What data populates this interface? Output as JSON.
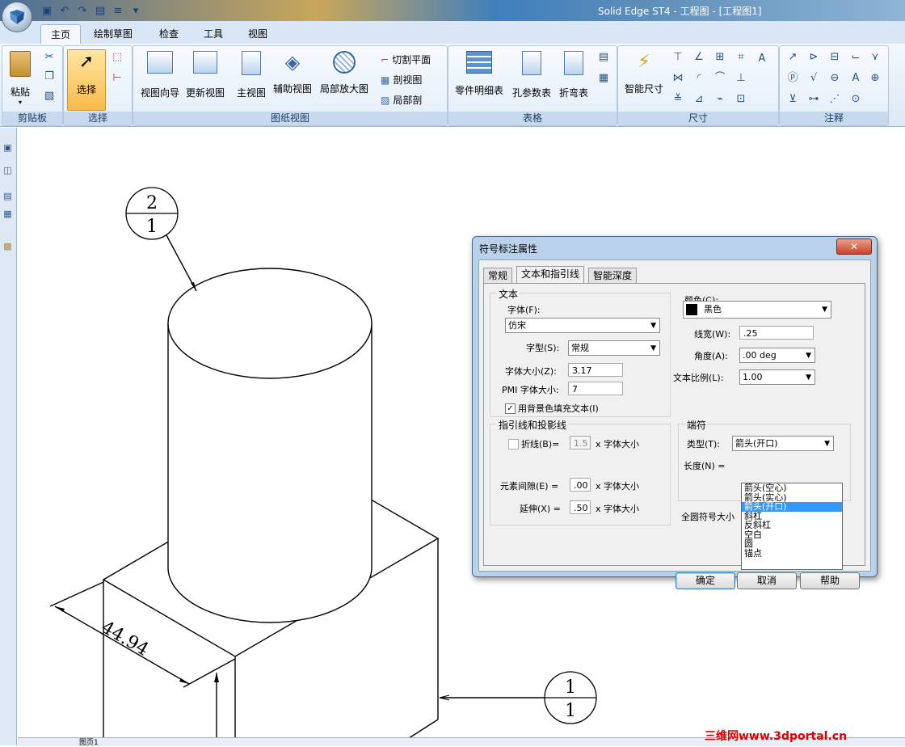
{
  "window": {
    "title": "Solid Edge ST4 - 工程图 - [工程图1]"
  },
  "ribbon_tabs": [
    "主页",
    "绘制草图",
    "检查",
    "工具",
    "视图"
  ],
  "active_tab": "主页",
  "groups": {
    "clipboard": {
      "label": "剪贴板",
      "paste": "粘贴"
    },
    "select": {
      "label": "选择",
      "select": "选择"
    },
    "drawing_views": {
      "label": "图纸视图",
      "view_wizard": "视图向导",
      "update_view": "更新视图",
      "main_view": "主视图",
      "aux_view": "辅助视图",
      "detail_view": "局部放大图",
      "cutting_plane": "切割平面",
      "section_view": "剖视图",
      "partial_section": "局部剖"
    },
    "tables": {
      "label": "表格",
      "parts_list": "零件明细表",
      "hole_table": "孔参数表",
      "bend_table": "折弯表"
    },
    "dimension": {
      "label": "尺寸",
      "smart_dimension": "智能尺寸"
    },
    "annotation": {
      "label": "注释"
    }
  },
  "drawing": {
    "balloon_top": {
      "upper": "2",
      "lower": "1"
    },
    "balloon_right": {
      "upper": "1",
      "lower": "1"
    },
    "dimension_value": "44.94"
  },
  "sheet_tab": "图页1",
  "watermark": "三维网www.3dportal.cn",
  "dialog": {
    "title": "符号标注属性",
    "close": "✕",
    "tabs": [
      "常规",
      "文本和指引线",
      "智能深度"
    ],
    "active_tab": "文本和指引线",
    "text_group": {
      "legend": "文本",
      "font_label": "字体(F):",
      "font_value": "仿宋",
      "style_label": "字型(S):",
      "style_value": "常规",
      "size_label": "字体大小(Z):",
      "size_value": "3.17",
      "pmi_label": "PMI 字体大小:",
      "pmi_value": "7",
      "fill_bg_label": "用背景色填充文本(I)",
      "fill_bg_checked": true
    },
    "color_label": "颜色(C):",
    "color_value": "黑色",
    "color_hex": "#000000",
    "linewidth_label": "线宽(W):",
    "linewidth_value": ".25",
    "angle_label": "角度(A):",
    "angle_value": ".00 deg",
    "text_scale_label": "文本比例(L):",
    "text_scale_value": "1.00",
    "leader_group": {
      "legend": "指引线和投影线",
      "break_label": "折线(B)=",
      "break_value": "1.5",
      "break_unit": "x 字体大小",
      "break_checked": false,
      "gap_label": "元素间隙(E) =",
      "gap_value": ".00",
      "gap_unit": "x 字体大小",
      "extend_label": "延伸(X) =",
      "extend_value": ".50",
      "extend_unit": "x 字体大小"
    },
    "terminator_group": {
      "legend": "端符",
      "type_label": "类型(T):",
      "type_value": "箭头(开口)",
      "length_label": "长度(N) =",
      "options": [
        "箭头(空心)",
        "箭头(实心)",
        "箭头(开口)",
        "斜杠",
        "反斜杠",
        "空白",
        "圆",
        "锚点"
      ],
      "selected_index": 2
    },
    "full_circle_label": "全圆符号大小",
    "buttons": {
      "ok": "确定",
      "cancel": "取消",
      "help": "帮助"
    }
  }
}
